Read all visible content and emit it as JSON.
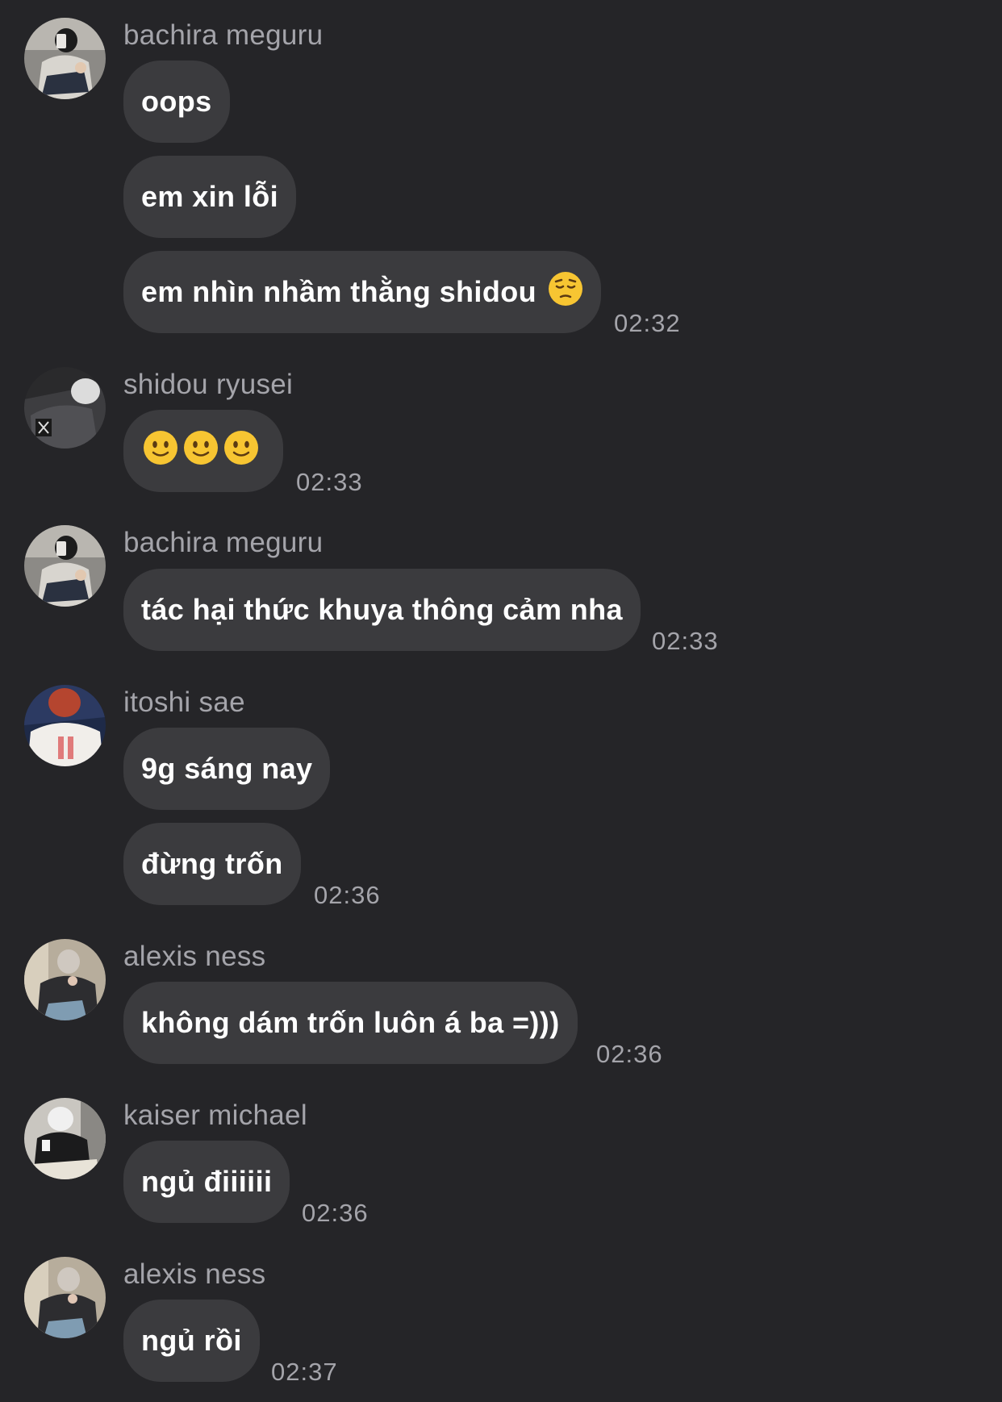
{
  "messages": [
    {
      "sender": "bachira meguru",
      "avatar_icon": "avatar-bachira-icon",
      "bubbles": [
        "oops",
        "em xin lỗi",
        "em nhìn nhầm thằng shidou"
      ],
      "emoji_after_last": "pensive-face-icon",
      "time": "02:32"
    },
    {
      "sender": "shidou ryusei",
      "avatar_icon": "avatar-shidou-icon",
      "bubbles": [
        ""
      ],
      "emoji_only": [
        "slightly-smiling-face-icon",
        "slightly-smiling-face-icon",
        "slightly-smiling-face-icon"
      ],
      "time": "02:33"
    },
    {
      "sender": "bachira meguru",
      "avatar_icon": "avatar-bachira-icon",
      "bubbles": [
        "tác hại thức khuya thông cảm nha"
      ],
      "time": "02:33"
    },
    {
      "sender": "itoshi sae",
      "avatar_icon": "avatar-sae-icon",
      "bubbles": [
        "9g sáng nay",
        "đừng trốn"
      ],
      "time": "02:36"
    },
    {
      "sender": "alexis ness",
      "avatar_icon": "avatar-ness-icon",
      "bubbles": [
        "không dám trốn luôn á ba =)))"
      ],
      "time": "02:36"
    },
    {
      "sender": "kaiser michael",
      "avatar_icon": "avatar-kaiser-icon",
      "bubbles": [
        "ngủ điiiiii"
      ],
      "time": "02:36"
    },
    {
      "sender": "alexis ness",
      "avatar_icon": "avatar-ness-icon",
      "bubbles": [
        "ngủ rồi"
      ],
      "time": "02:37"
    }
  ],
  "colors": {
    "background": "#252528",
    "bubble": "#3b3b3e",
    "secondary_text": "#a4a4aa",
    "emoji_yellow": "#f7c532"
  }
}
